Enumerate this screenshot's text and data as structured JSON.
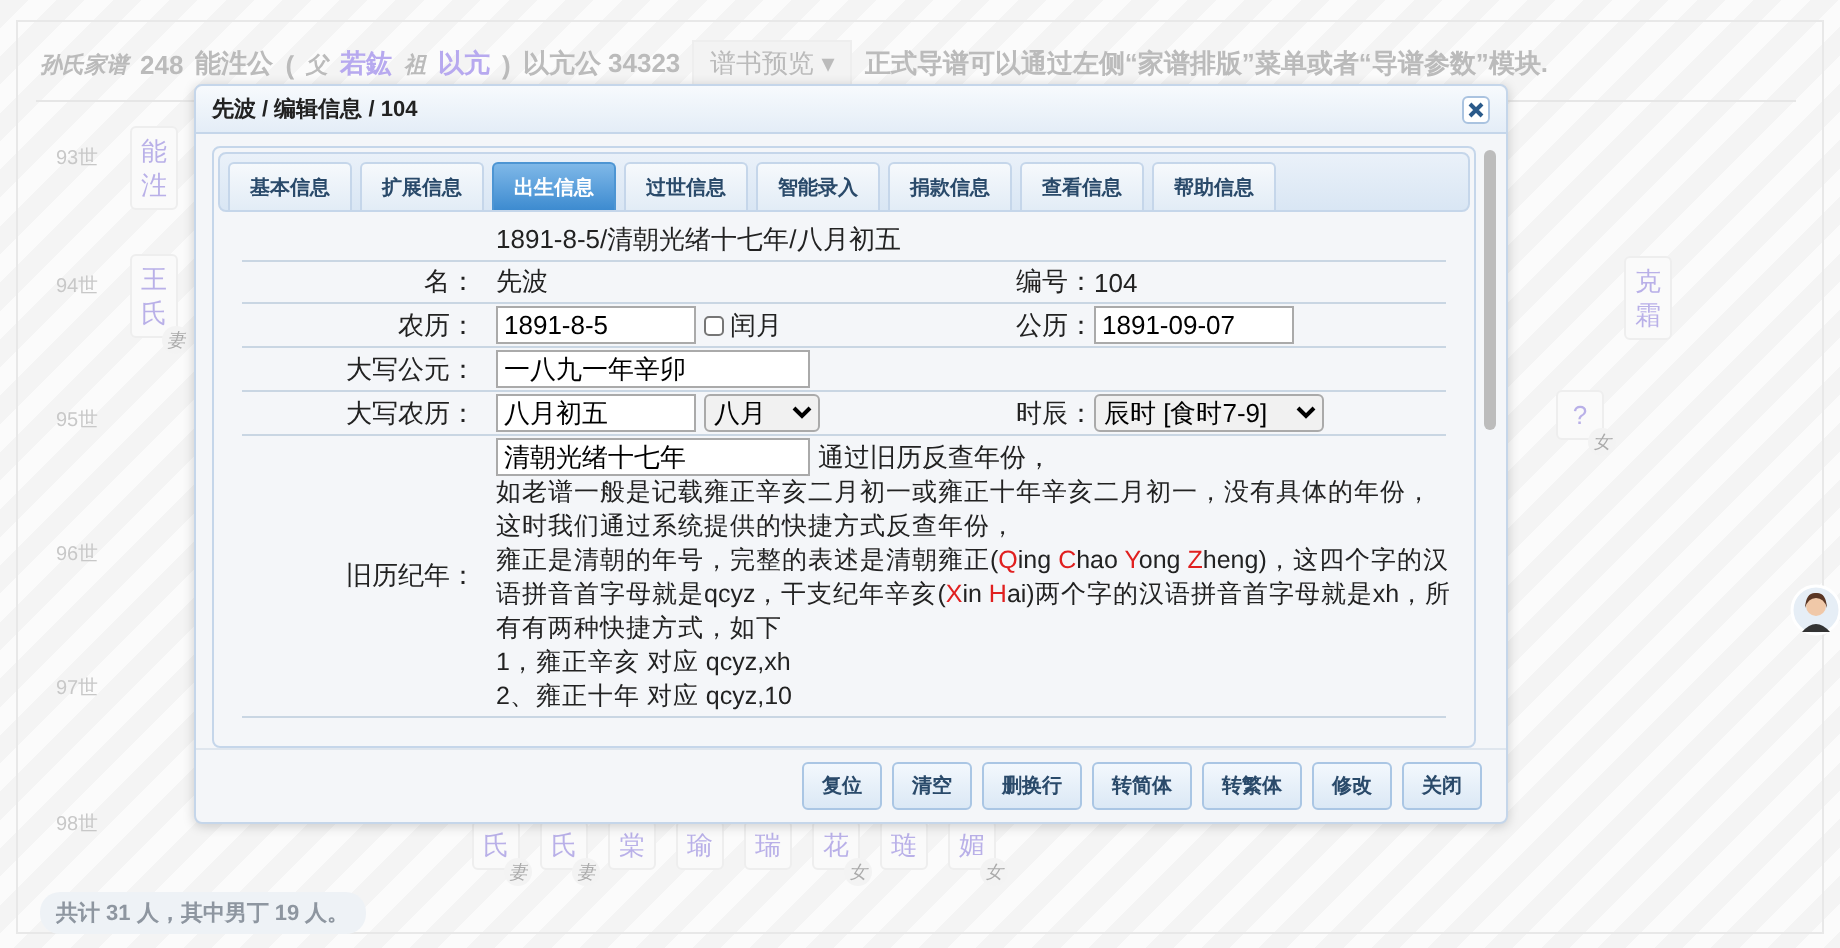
{
  "header": {
    "family": "孙氏家谱",
    "count": "248",
    "person": "能泩公",
    "open": "(",
    "father_label": "父",
    "father": "若鈜",
    "grand_label": "祖",
    "grand": "以亢",
    "close": ")",
    "ancestor": "以亢公 34323",
    "preview": "谱书预览",
    "preview_caret": "▾",
    "hint": "正式导谱可以通过左侧“家谱排版”菜单或者“导谱参数”模块."
  },
  "generations": [
    "93世",
    "94世",
    "95世",
    "96世",
    "97世",
    "98世"
  ],
  "nodes": [
    {
      "chars": [
        "能",
        "泩"
      ]
    },
    {
      "chars": [
        "王",
        "氏"
      ],
      "badge": "妻"
    },
    {
      "chars": [
        "克",
        "霜"
      ]
    },
    {
      "chars": [
        "?"
      ],
      "badge": "女"
    },
    {
      "chars": [
        "氏"
      ],
      "badge": "妻"
    },
    {
      "chars": [
        "氏"
      ],
      "badge": "妻"
    },
    {
      "chars": [
        "棠"
      ]
    },
    {
      "chars": [
        "瑜"
      ]
    },
    {
      "chars": [
        "瑞"
      ]
    },
    {
      "chars": [
        "花"
      ],
      "badge": "女"
    },
    {
      "chars": [
        "琏"
      ]
    },
    {
      "chars": [
        "媚"
      ],
      "badge": "女"
    }
  ],
  "footer": "共计 31 人，其中男丁 19 人。",
  "dialog": {
    "title": "先波 / 编辑信息 / 104",
    "tabs": [
      {
        "label": "基本信息",
        "selected": false
      },
      {
        "label": "扩展信息",
        "selected": false
      },
      {
        "label": "出生信息",
        "selected": true
      },
      {
        "label": "过世信息",
        "selected": false
      },
      {
        "label": "智能录入",
        "selected": false
      },
      {
        "label": "捐款信息",
        "selected": false
      },
      {
        "label": "查看信息",
        "selected": false
      },
      {
        "label": "帮助信息",
        "selected": false
      }
    ],
    "summary": "1891-8-5/清朝光绪十七年/八月初五",
    "name_label": "名：",
    "name": "先波",
    "number_label": "编号：",
    "number": "104",
    "lunar_label": "农历：",
    "lunar": "1891-8-5",
    "leap_label": "闰月",
    "leap_checked": false,
    "solar_label": "公历：",
    "solar": "1891-09-07",
    "upper_year_label": "大写公元：",
    "upper_year": "一八九一年辛卯",
    "upper_lunar_label": "大写农历：",
    "upper_lunar": "八月初五",
    "month": "八月",
    "hour_label": "时辰：",
    "hour": "辰时 [食时7-9]",
    "old_year_label": "旧历纪年：",
    "old_year": "清朝光绪十七年",
    "old_year_hint": "通过旧历反查年份，",
    "help": [
      [
        {
          "text": "如老谱一般是记载雍正辛亥二月初一或雍正十年辛亥二月初一，没有具体的年份，这时我们通过系统提供的快捷方式反查年份，",
          "highlight": false
        }
      ],
      [
        {
          "text": "雍正是清朝的年号，完整的表述是清朝雍正(",
          "highlight": false
        },
        {
          "text": "Q",
          "highlight": true
        },
        {
          "text": "ing ",
          "highlight": false
        },
        {
          "text": "C",
          "highlight": true
        },
        {
          "text": "hao ",
          "highlight": false
        },
        {
          "text": "Y",
          "highlight": true
        },
        {
          "text": "ong ",
          "highlight": false
        },
        {
          "text": "Z",
          "highlight": true
        },
        {
          "text": "heng)，这四个字的汉语拼音首字母就是qcyz，干支纪年辛亥(",
          "highlight": false
        },
        {
          "text": "X",
          "highlight": true
        },
        {
          "text": "in ",
          "highlight": false
        },
        {
          "text": "H",
          "highlight": true
        },
        {
          "text": "ai)两个字的汉语拼音首字母就是xh，所有有两种快捷方式，如下",
          "highlight": false
        }
      ],
      [
        {
          "text": "1，雍正辛亥 对应 qcyz,xh",
          "highlight": false
        }
      ],
      [
        {
          "text": "2、雍正十年 对应 qcyz,10",
          "highlight": false
        }
      ]
    ],
    "buttons": [
      "复位",
      "清空",
      "删换行",
      "转简体",
      "转繁体",
      "修改",
      "关闭"
    ]
  }
}
